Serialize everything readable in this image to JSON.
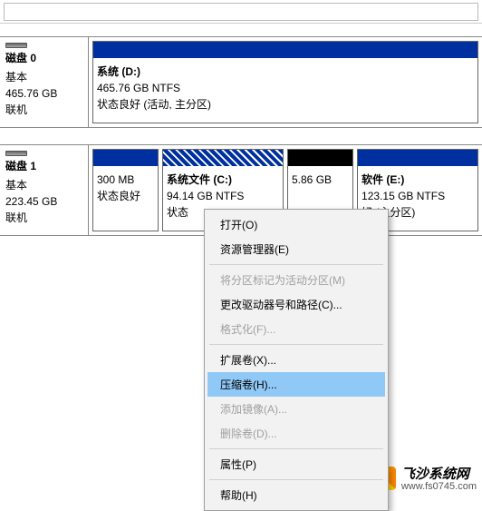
{
  "topbar": {
    "value": ""
  },
  "disks": [
    {
      "title": "磁盘 0",
      "type": "基本",
      "size": "465.76 GB",
      "status": "联机",
      "partitions": [
        {
          "label": "系统  (D:)",
          "size": "465.76 GB NTFS",
          "state": "状态良好 (活动, 主分区)",
          "head": "solid"
        }
      ]
    },
    {
      "title": "磁盘 1",
      "type": "基本",
      "size": "223.45 GB",
      "status": "联机",
      "partitions": [
        {
          "label": "",
          "size": "300 MB",
          "state": "状态良好",
          "head": "solid"
        },
        {
          "label": "系统文件  (C:)",
          "size": "94.14 GB NTFS",
          "state": "状态",
          "head": "hatch"
        },
        {
          "label": "",
          "size": "5.86 GB",
          "state": "",
          "head": "black"
        },
        {
          "label": "软件  (E:)",
          "size": "123.15 GB NTFS",
          "state": "好 (主分区)",
          "head": "solid"
        }
      ]
    }
  ],
  "menu": {
    "open": "打开(O)",
    "explorer": "资源管理器(E)",
    "mark_active": "将分区标记为活动分区(M)",
    "change_letter": "更改驱动器号和路径(C)...",
    "format": "格式化(F)...",
    "extend": "扩展卷(X)...",
    "shrink": "压缩卷(H)...",
    "mirror": "添加镜像(A)...",
    "delete": "删除卷(D)...",
    "properties": "属性(P)",
    "help": "帮助(H)"
  },
  "watermark": {
    "line1": "飞沙系统网",
    "line2": "www.fs0745.com"
  }
}
